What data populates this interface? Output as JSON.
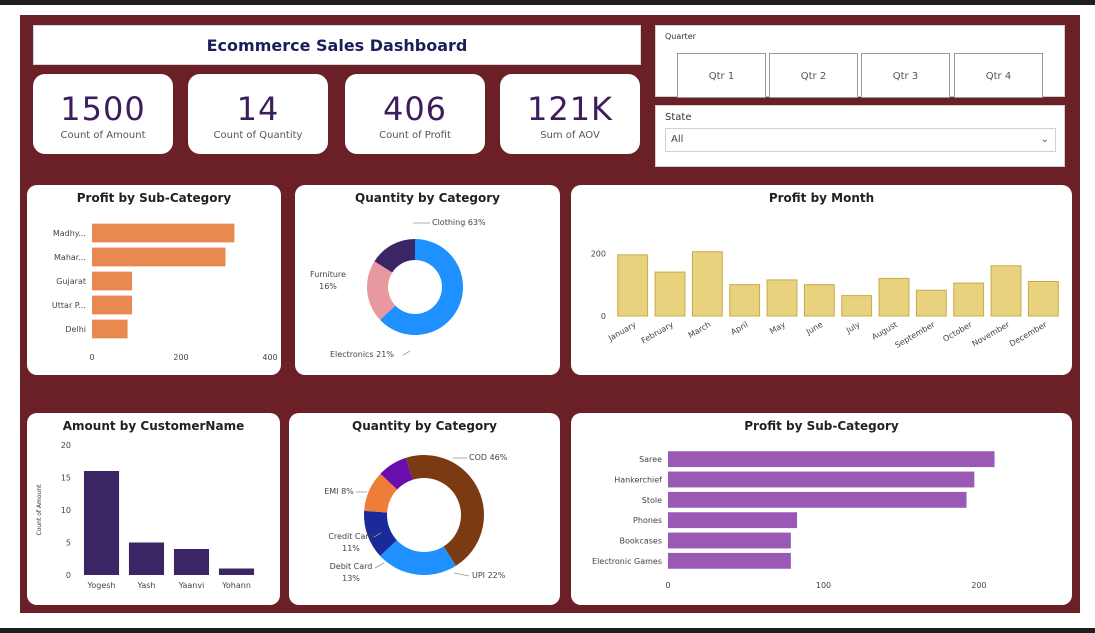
{
  "dashboard": {
    "title": "Ecommerce Sales Dashboard"
  },
  "kpis": [
    {
      "value": "1500",
      "label": "Count of Amount"
    },
    {
      "value": "14",
      "label": "Count of Quantity"
    },
    {
      "value": "406",
      "label": "Count of Profit"
    },
    {
      "value": "121K",
      "label": "Sum of AOV"
    }
  ],
  "quarter_slicer": {
    "title": "Quarter",
    "options": [
      "Qtr 1",
      "Qtr 2",
      "Qtr 3",
      "Qtr 4"
    ]
  },
  "state_slicer": {
    "title": "State",
    "selected": "All"
  },
  "colors": {
    "frame": "#6b1f27",
    "orange": "#e8894f",
    "gold": "#e8d27e",
    "navy": "#3a2565",
    "purple": "#9b59b6",
    "kpi_text": "#3d1d5c"
  },
  "chart_data": [
    {
      "type": "bar",
      "orientation": "horizontal",
      "title": "Profit by Sub-Category",
      "categories": [
        "Madhy...",
        "Mahar...",
        "Gujarat",
        "Uttar P...",
        "Delhi"
      ],
      "values": [
        320,
        300,
        90,
        90,
        80
      ],
      "xlim": [
        0,
        400
      ],
      "xticks": [
        "0",
        "200",
        "400"
      ],
      "color": "#e8894f"
    },
    {
      "type": "pie",
      "donut": true,
      "title": "Quantity by Category",
      "slices": [
        {
          "label": "Clothing 63%",
          "value": 63,
          "color": "#1e90ff"
        },
        {
          "label": "Electronics 21%",
          "value": 21,
          "color": "#e8999f"
        },
        {
          "label": "Furniture",
          "label2": "16%",
          "value": 16,
          "color": "#3a2565"
        }
      ]
    },
    {
      "type": "bar",
      "title": "Profit by Month",
      "categories": [
        "January",
        "February",
        "March",
        "April",
        "May",
        "June",
        "July",
        "August",
        "September",
        "October",
        "November",
        "December"
      ],
      "values": [
        195,
        140,
        205,
        100,
        115,
        100,
        65,
        120,
        82,
        105,
        160,
        110
      ],
      "ylim": [
        0,
        220
      ],
      "yticks": [
        "0",
        "200"
      ],
      "color": "#e8d27e"
    },
    {
      "type": "bar",
      "title": "Amount by CustomerName",
      "ylabel": "Count of Amount",
      "categories": [
        "Yogesh",
        "Yash",
        "Yaanvi",
        "Yohann"
      ],
      "values": [
        16,
        5,
        4,
        1
      ],
      "ylim": [
        0,
        20
      ],
      "yticks": [
        "0",
        "5",
        "10",
        "15",
        "20"
      ],
      "color": "#3a2565"
    },
    {
      "type": "pie",
      "donut": true,
      "title": "Quantity by Category",
      "slices": [
        {
          "label": "COD 46%",
          "value": 46,
          "color": "#7b3a12"
        },
        {
          "label": "UPI 22%",
          "value": 22,
          "color": "#1e90ff"
        },
        {
          "label": "Debit Card",
          "label2": "13%",
          "value": 13,
          "color": "#1a2a99"
        },
        {
          "label": "Credit Card",
          "label2": "11%",
          "value": 11,
          "color": "#f07c3a"
        },
        {
          "label": "EMI 8%",
          "value": 8,
          "color": "#6a0dad"
        }
      ]
    },
    {
      "type": "bar",
      "orientation": "horizontal",
      "title": "Profit by Sub-Category",
      "categories": [
        "Saree",
        "Hankerchief",
        "Stole",
        "Phones",
        "Bookcases",
        "Electronic Games"
      ],
      "values": [
        210,
        197,
        192,
        83,
        79,
        79
      ],
      "xlim": [
        0,
        200
      ],
      "xticks": [
        "0",
        "100",
        "200"
      ],
      "color": "#9b59b6"
    }
  ]
}
